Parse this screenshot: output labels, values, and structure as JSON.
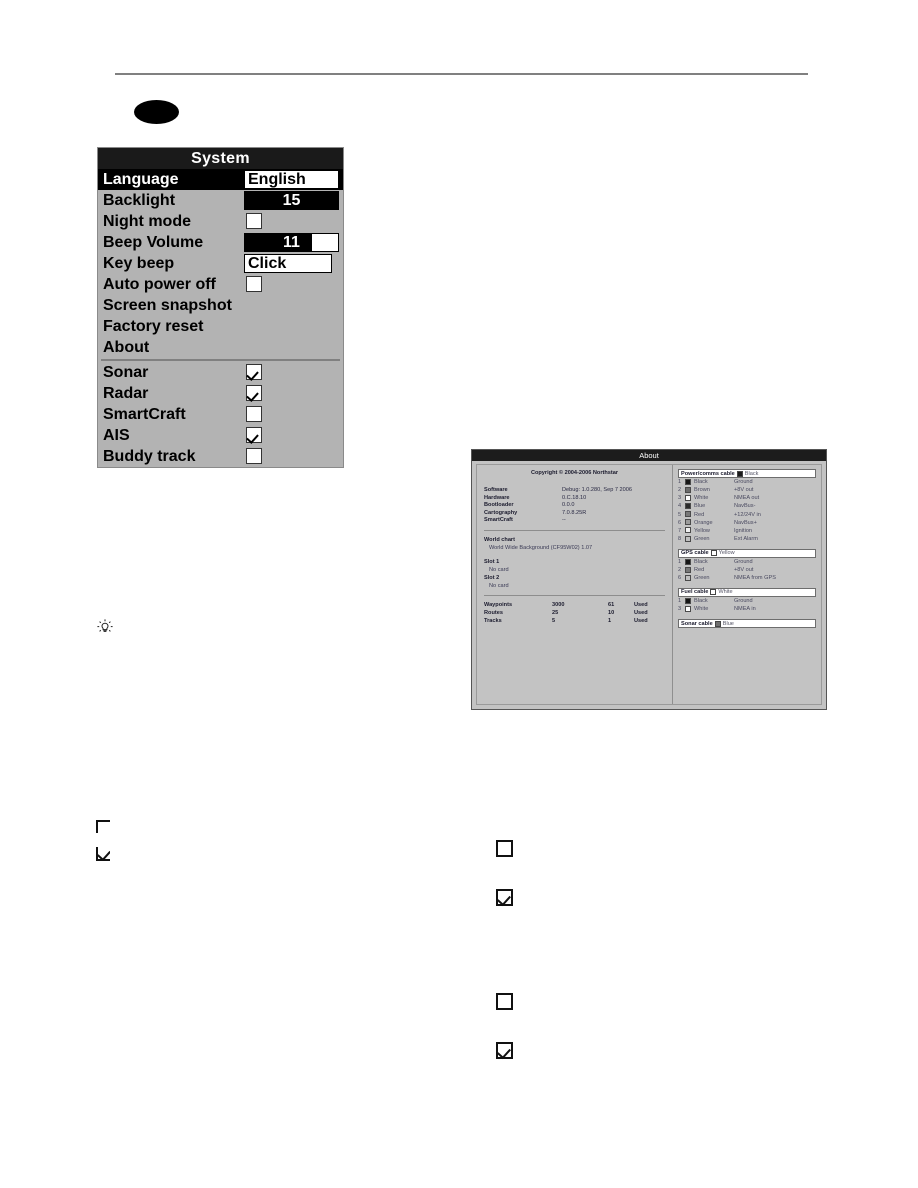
{
  "page": {
    "rule_label": "horizontal-rule",
    "redaction_label": "redacted-oval"
  },
  "system_menu": {
    "title": "System",
    "rows": [
      {
        "label": "Language",
        "type": "text",
        "value": "English",
        "selected": true
      },
      {
        "label": "Backlight",
        "type": "bar",
        "value": "15",
        "fill_percent": 100
      },
      {
        "label": "Night mode",
        "type": "check",
        "checked": false
      },
      {
        "label": "Beep Volume",
        "type": "bar",
        "value": "11",
        "fill_percent": 72
      },
      {
        "label": "Key beep",
        "type": "text",
        "value": "Click"
      },
      {
        "label": "Auto power off",
        "type": "check",
        "checked": false
      },
      {
        "label": "Screen snapshot",
        "type": "none"
      },
      {
        "label": "Factory reset",
        "type": "none"
      },
      {
        "label": "About",
        "type": "none"
      }
    ],
    "options": [
      {
        "label": "Sonar",
        "checked": true
      },
      {
        "label": "Radar",
        "checked": true
      },
      {
        "label": "SmartCraft",
        "checked": false
      },
      {
        "label": "AIS",
        "checked": true
      },
      {
        "label": "Buddy track",
        "checked": false
      }
    ]
  },
  "about": {
    "title": "About",
    "copyright": "Copyright © 2004-2006 Northstar",
    "versions": [
      {
        "label": "Software",
        "value": "Debug: 1.0.280, Sep  7 2006"
      },
      {
        "label": "Hardware",
        "value": "0.C.18.10"
      },
      {
        "label": "Bootloader",
        "value": "0.0.0"
      },
      {
        "label": "Cartography",
        "value": "7.0.8.25R"
      },
      {
        "label": "SmartCraft",
        "value": "--"
      }
    ],
    "world_chart": {
      "heading": "World chart",
      "value": "World Wide Background (CF95W02) 1.07"
    },
    "slots": [
      {
        "heading": "Slot 1",
        "value": "No card"
      },
      {
        "heading": "Slot 2",
        "value": "No card"
      }
    ],
    "capacity": [
      {
        "name": "Waypoints",
        "total": "3000",
        "used": "61",
        "used_label": "Used"
      },
      {
        "name": "Routes",
        "total": "25",
        "used": "10",
        "used_label": "Used"
      },
      {
        "name": "Tracks",
        "total": "5",
        "used": "1",
        "used_label": "Used"
      }
    ],
    "cables": [
      {
        "name": "Power/comms cable",
        "color_name": "Black",
        "color_hex": "#1a1a1a",
        "pins": [
          {
            "num": "1",
            "color": "Black",
            "hex": "#151515",
            "func": "Ground"
          },
          {
            "num": "2",
            "color": "Brown",
            "hex": "#6b6b6b",
            "func": "+8V out"
          },
          {
            "num": "3",
            "color": "White",
            "hex": "#ffffff",
            "func": "NMEA out"
          },
          {
            "num": "4",
            "color": "Blue",
            "hex": "#2b2b2b",
            "func": "NavBus-"
          },
          {
            "num": "5",
            "color": "Red",
            "hex": "#777777",
            "func": "+12/24V in"
          },
          {
            "num": "6",
            "color": "Orange",
            "hex": "#9a9a9a",
            "func": "NavBus+"
          },
          {
            "num": "7",
            "color": "Yellow",
            "hex": "#f0f0f0",
            "func": "Ignition"
          },
          {
            "num": "8",
            "color": "Green",
            "hex": "#bfbfbf",
            "func": "Ext Alarm"
          }
        ]
      },
      {
        "name": "GPS cable",
        "color_name": "Yellow",
        "color_hex": "#ffffff",
        "pins": [
          {
            "num": "1",
            "color": "Black",
            "hex": "#151515",
            "func": "Ground"
          },
          {
            "num": "2",
            "color": "Red",
            "hex": "#777777",
            "func": "+8V out"
          },
          {
            "num": "6",
            "color": "Green",
            "hex": "#bfbfbf",
            "func": "NMEA from GPS"
          }
        ]
      },
      {
        "name": "Fuel cable",
        "color_name": "White",
        "color_hex": "#ffffff",
        "pins": [
          {
            "num": "1",
            "color": "Black",
            "hex": "#151515",
            "func": "Ground"
          },
          {
            "num": "3",
            "color": "White",
            "hex": "#ffffff",
            "func": "NMEA in"
          }
        ]
      },
      {
        "name": "Sonar cable",
        "color_name": "Blue",
        "color_hex": "#6e6e6e",
        "pins": []
      }
    ]
  },
  "body_marks": {
    "tip_icon": "lightbulb-icon",
    "checkboxes": [
      {
        "id": "left-unchecked-clipped",
        "checked": false
      },
      {
        "id": "left-checked-clipped",
        "checked": true
      },
      {
        "id": "right-unchecked-top",
        "checked": false
      },
      {
        "id": "right-checked-top",
        "checked": true
      },
      {
        "id": "right-unchecked-bottom",
        "checked": false
      },
      {
        "id": "right-checked-bottom",
        "checked": true
      }
    ]
  }
}
